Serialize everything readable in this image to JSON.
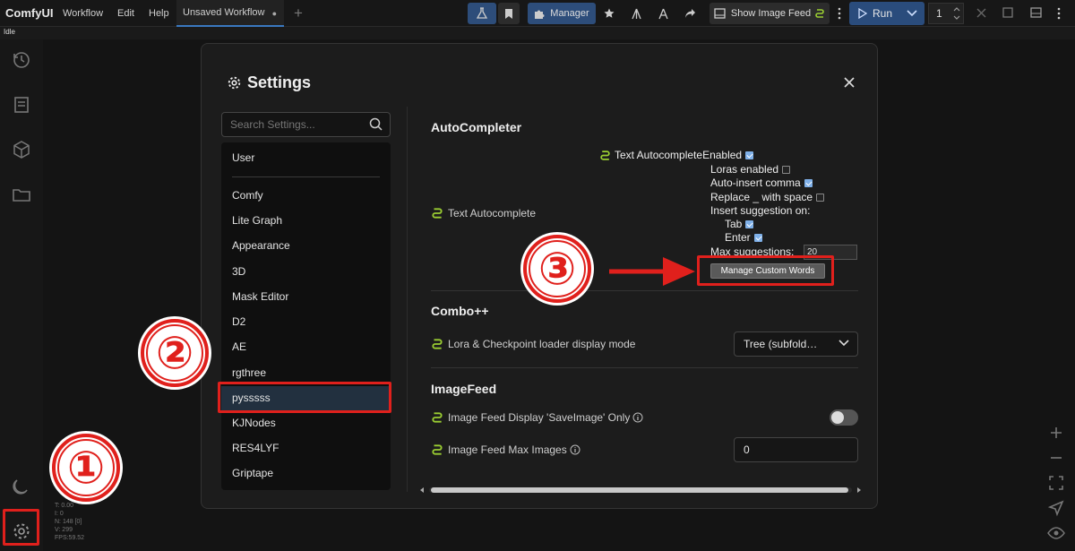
{
  "app": {
    "brand": "ComfyUI",
    "menu": [
      "Workflow",
      "Edit",
      "Help"
    ],
    "tab_title": "Unsaved Workflow",
    "tab_dot": "●",
    "new_tab": "+",
    "manager_label": "Manager",
    "show_image_feed_label": "Show Image Feed",
    "run_label": "Run",
    "run_count": "1",
    "status": "Idle"
  },
  "stats": [
    "T: 0.00",
    "I: 0",
    "N: 148 [0]",
    "V: 299",
    "FPS:59.52"
  ],
  "settings": {
    "title": "Settings",
    "search_placeholder": "Search Settings...",
    "categories": [
      "User",
      "Comfy",
      "Lite Graph",
      "Appearance",
      "3D",
      "Mask Editor",
      "D2",
      "AE",
      "rgthree",
      "pysssss",
      "KJNodes",
      "RES4LYF",
      "Griptape"
    ],
    "selected_category": "pysssss",
    "sections": {
      "autocompleter": {
        "title": "AutoCompleter",
        "setting_label": "Text Autocomplete",
        "panel_label": "Text Autocomplete",
        "enabled": "Enabled",
        "loras": "Loras enabled",
        "auto_comma": "Auto-insert comma",
        "replace": "Replace _ with space",
        "insert_on": "Insert suggestion on:",
        "tab": "Tab",
        "enter": "Enter",
        "max_sugg": "Max suggestions:",
        "max_sugg_value": "20",
        "manage_btn": "Manage Custom Words"
      },
      "combo": {
        "title": "Combo++",
        "setting_label": "Lora & Checkpoint loader display mode",
        "select_value": "Tree (subfold…"
      },
      "imagefeed": {
        "title": "ImageFeed",
        "display_label": "Image Feed Display 'SaveImage' Only",
        "max_label": "Image Feed Max Images",
        "max_value": "0"
      }
    }
  },
  "badges": [
    "①",
    "②",
    "③"
  ],
  "colors": {
    "annotation_red": "#e0201c",
    "accent_blue": "#2d4d7a",
    "checkbox_blue": "#7fb0e8"
  }
}
